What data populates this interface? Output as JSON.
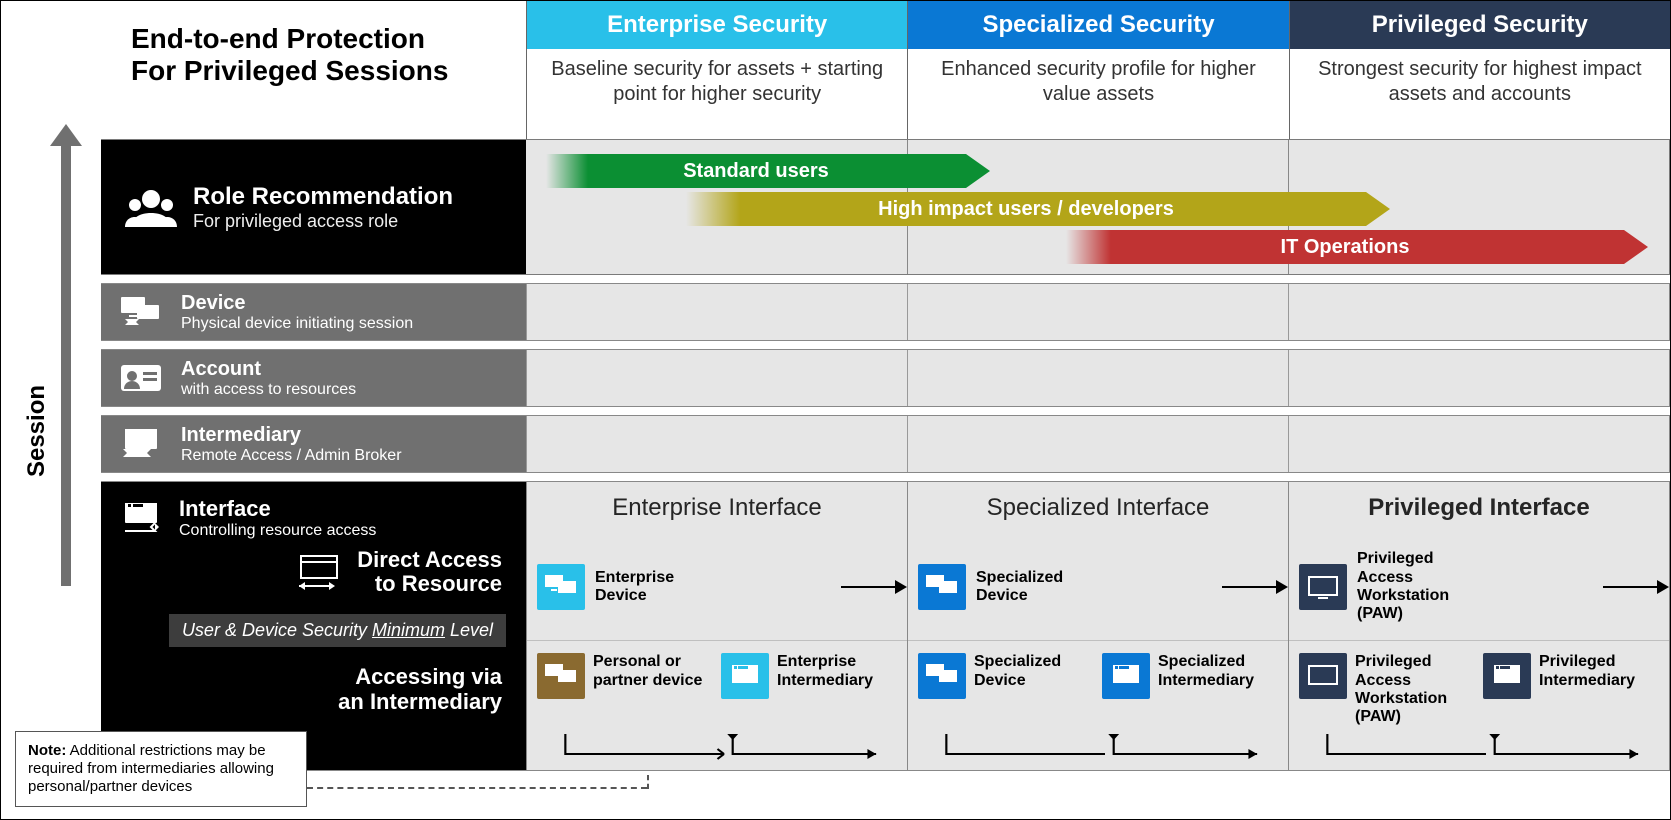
{
  "title_line1": "End-to-end Protection",
  "title_line2": "For Privileged Sessions",
  "session_axis": "Session",
  "tiers": [
    {
      "key": "ent",
      "title": "Enterprise Security",
      "desc": "Baseline security for assets + starting point for higher security",
      "color": "#29c0e9"
    },
    {
      "key": "spec",
      "title": "Specialized Security",
      "desc": "Enhanced security profile for higher value assets",
      "color": "#0a78d4"
    },
    {
      "key": "priv",
      "title": "Privileged Security",
      "desc": "Strongest security for highest impact assets and accounts",
      "color": "#2a3a55"
    }
  ],
  "role": {
    "title": "Role Recommendation",
    "sub": "For privileged access role",
    "bars": [
      {
        "label": "Standard users",
        "color": "#0b8f33"
      },
      {
        "label": "High impact users / developers",
        "color": "#b3a519"
      },
      {
        "label": "IT Operations",
        "color": "#c03333"
      }
    ]
  },
  "layers": [
    {
      "title": "Device",
      "sub": "Physical device initiating session"
    },
    {
      "title": "Account",
      "sub": "with access to resources"
    },
    {
      "title": "Intermediary",
      "sub": "Remote Access / Admin Broker"
    }
  ],
  "interface": {
    "title": "Interface",
    "sub": "Controlling resource access",
    "direct_label": "Direct Access\nto Resource",
    "minimum": "User & Device Security Minimum Level",
    "via_label": "Accessing via\nan Intermediary"
  },
  "col": {
    "ent": {
      "iface_title": "Enterprise Interface",
      "direct_device": "Enterprise Device",
      "via_device": "Personal or partner device",
      "via_interm": "Enterprise Intermediary"
    },
    "spec": {
      "iface_title": "Specialized Interface",
      "direct_device": "Specialized Device",
      "via_device": "Specialized Device",
      "via_interm": "Specialized Intermediary"
    },
    "priv": {
      "iface_title": "Privileged Interface",
      "direct_device": "Privileged Access Workstation (PAW)",
      "via_device": "Privileged Access Workstation (PAW)",
      "via_interm": "Privileged Intermediary"
    }
  },
  "note": {
    "label": "Note:",
    "body": "Additional restrictions may be required from intermediaries allowing personal/partner devices"
  }
}
